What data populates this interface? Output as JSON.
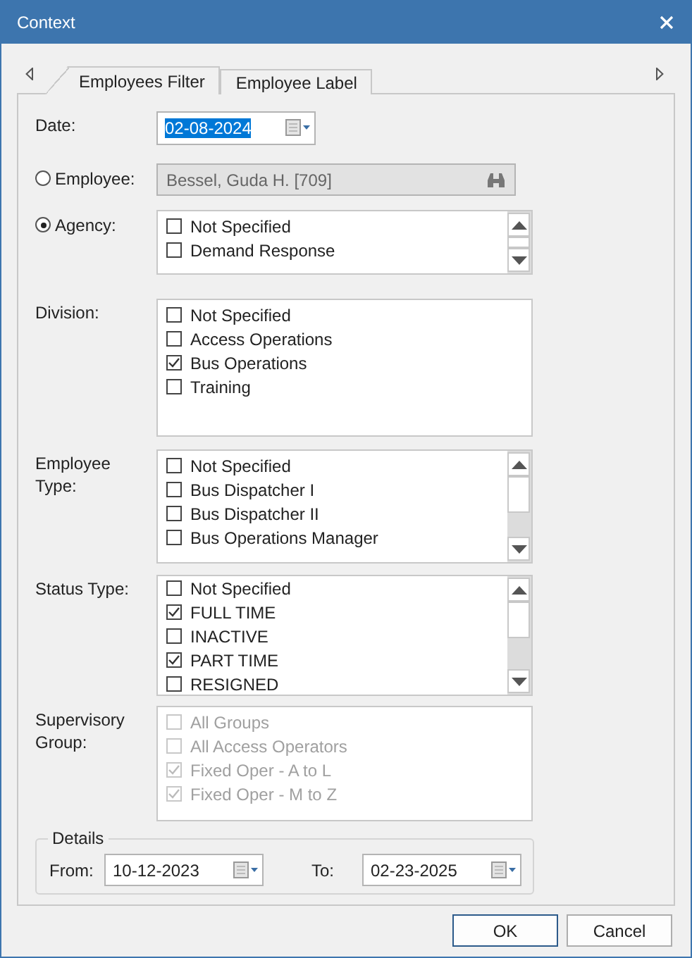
{
  "window": {
    "title": "Context"
  },
  "tabs": [
    {
      "label": "Employees Filter",
      "selected": true
    },
    {
      "label": "Employee Label",
      "selected": false
    }
  ],
  "date": {
    "label": "Date:",
    "value": "02-08-2024",
    "highlighted": true
  },
  "employee": {
    "label": "Employee:",
    "selected": false,
    "value": "Bessel, Guda H.  [709]"
  },
  "agency": {
    "label": "Agency:",
    "selected": true,
    "scrollable": true,
    "items": [
      {
        "label": "Not Specified",
        "checked": false
      },
      {
        "label": "Demand Response",
        "checked": false
      }
    ]
  },
  "filters": [
    {
      "label": "Division:",
      "scrollable": false,
      "disabled": false,
      "items": [
        {
          "label": "Not Specified",
          "checked": false
        },
        {
          "label": "Access Operations",
          "checked": false
        },
        {
          "label": "Bus Operations",
          "checked": true
        },
        {
          "label": "Training",
          "checked": false
        }
      ]
    },
    {
      "label": "Employee Type:",
      "scrollable": true,
      "disabled": false,
      "items": [
        {
          "label": "Not Specified",
          "checked": false
        },
        {
          "label": "Bus Dispatcher I",
          "checked": false
        },
        {
          "label": "Bus Dispatcher II",
          "checked": false
        },
        {
          "label": "Bus Operations Manager",
          "checked": false
        }
      ]
    },
    {
      "label": "Status Type:",
      "scrollable": true,
      "disabled": false,
      "items": [
        {
          "label": "Not Specified",
          "checked": false
        },
        {
          "label": "FULL TIME",
          "checked": true
        },
        {
          "label": "INACTIVE",
          "checked": false
        },
        {
          "label": "PART TIME",
          "checked": true
        },
        {
          "label": "RESIGNED",
          "checked": false
        }
      ]
    },
    {
      "label": "Supervisory Group:",
      "scrollable": false,
      "disabled": true,
      "items": [
        {
          "label": "All Groups",
          "checked": false
        },
        {
          "label": "All Access Operators",
          "checked": false
        },
        {
          "label": "Fixed Oper -  A to L",
          "checked": true
        },
        {
          "label": "Fixed Oper - M to Z",
          "checked": true
        }
      ]
    }
  ],
  "details": {
    "title": "Details",
    "from": {
      "label": "From:",
      "value": "10-12-2023"
    },
    "to": {
      "label": "To:",
      "value": "02-23-2025"
    }
  },
  "buttons": [
    {
      "label": "OK",
      "default": true
    },
    {
      "label": "Cancel",
      "default": false
    }
  ]
}
